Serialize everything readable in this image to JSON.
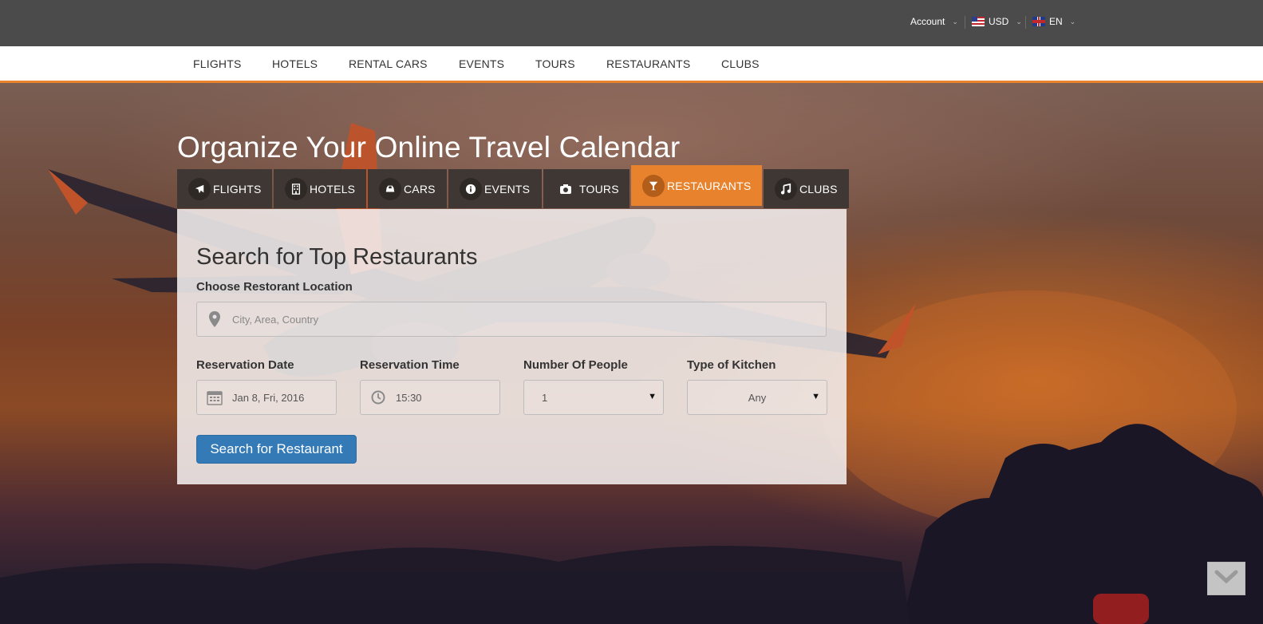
{
  "topbar": {
    "account_label": "Account",
    "currency_label": "USD",
    "language_label": "EN",
    "caret": "⌄"
  },
  "main_nav": {
    "items": [
      "FLIGHTS",
      "HOTELS",
      "RENTAL CARS",
      "EVENTS",
      "TOURS",
      "RESTAURANTS",
      "CLUBS"
    ]
  },
  "hero": {
    "title": "Organize Your Online Travel Calendar"
  },
  "tabs": [
    {
      "label": "FLIGHTS",
      "icon": "plane-icon",
      "active": false
    },
    {
      "label": "HOTELS",
      "icon": "building-icon",
      "active": false
    },
    {
      "label": "CARS",
      "icon": "car-icon",
      "active": false
    },
    {
      "label": "EVENTS",
      "icon": "info-icon",
      "active": false
    },
    {
      "label": "TOURS",
      "icon": "camera-icon",
      "active": false
    },
    {
      "label": "RESTAURANTS",
      "icon": "cocktail-glass-icon",
      "active": true
    },
    {
      "label": "CLUBS",
      "icon": "music-note-icon",
      "active": false
    }
  ],
  "search": {
    "heading": "Search for Top Restaurants",
    "location_label": "Choose Restorant Location",
    "location_placeholder": "City, Area, Country",
    "date_label": "Reservation Date",
    "date_value": "Jan 8, Fri, 2016",
    "time_label": "Reservation Time",
    "time_value": "15:30",
    "people_label": "Number Of People",
    "people_value": "1",
    "kitchen_label": "Type of Kitchen",
    "kitchen_value": "Any",
    "submit_label": "Search for Restaurant"
  },
  "colors": {
    "accent": "#e8822d",
    "topbar": "#4b4b4b",
    "tab_bg": "#3f3734",
    "button": "#337ab7"
  }
}
